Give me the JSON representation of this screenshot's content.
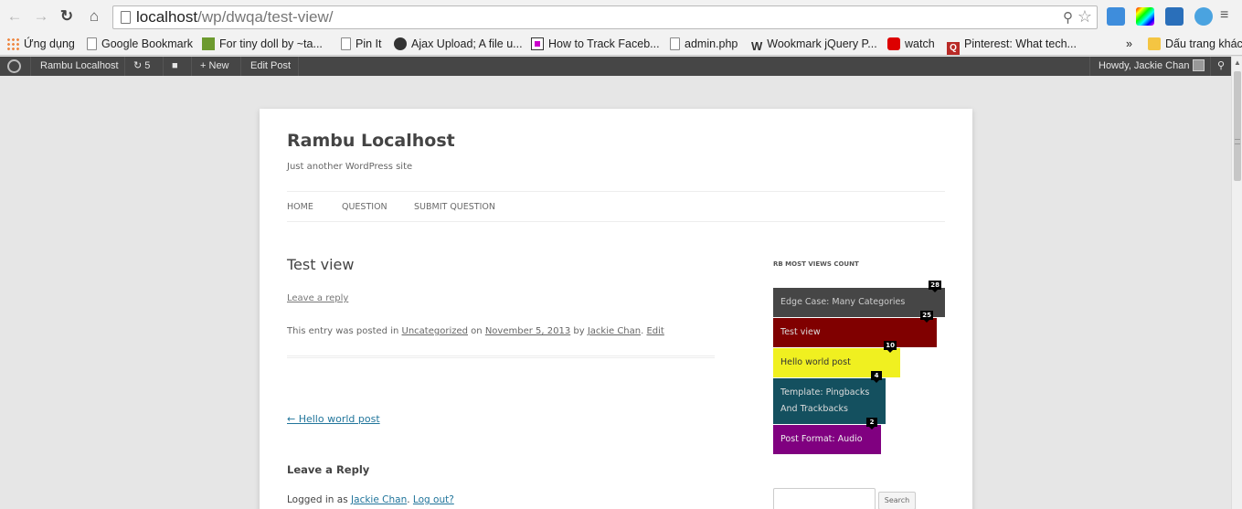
{
  "browser": {
    "url_host": "localhost",
    "url_path": "/wp/dwqa/test-view/",
    "bookmarks": [
      {
        "label": "Ứng dụng",
        "icon": "apps-icon"
      },
      {
        "label": "Google Bookmark",
        "icon": "page-icon"
      },
      {
        "label": "For tiny doll by ~ta...",
        "icon": "deviantart-icon"
      },
      {
        "label": "Pin It",
        "icon": "page-icon"
      },
      {
        "label": "Ajax Upload; A file u...",
        "icon": "github-icon"
      },
      {
        "label": "How to Track Faceb...",
        "icon": "page-icon"
      },
      {
        "label": "admin.php",
        "icon": "page-icon"
      },
      {
        "label": "Wookmark jQuery P...",
        "icon": "wookmark-icon"
      },
      {
        "label": "watch",
        "icon": "youtube-icon"
      },
      {
        "label": "Pinterest: What tech...",
        "icon": "quora-icon"
      }
    ],
    "more_bookmarks": "»",
    "other_bookmarks": "Dấu trang khác"
  },
  "adminbar": {
    "site_name": "Rambu Localhost",
    "updates_count": "5",
    "new_label": "New",
    "edit_label": "Edit Post",
    "howdy": "Howdy, Jackie Chan"
  },
  "site": {
    "title": "Rambu Localhost",
    "description": "Just another WordPress site",
    "nav": [
      "HOME",
      "QUESTION",
      "SUBMIT QUESTION"
    ]
  },
  "entry": {
    "title": "Test view",
    "leave_reply": "Leave a reply",
    "meta_prefix": "This entry was posted in",
    "category": "Uncategorized",
    "meta_on": "on",
    "date": "November 5, 2013",
    "meta_by": "by",
    "author": "Jackie Chan",
    "edit": "Edit",
    "prev_post": "← Hello world post",
    "reply_title": "Leave a Reply",
    "logged_in_prefix": "Logged in as",
    "logged_in_user": "Jackie Chan",
    "logout": "Log out?"
  },
  "widget": {
    "title": "RB MOST VIEWS COUNT",
    "items": [
      {
        "title": "Edge Case: Many Categories",
        "count": "28",
        "bg": "#464646",
        "fg": "#cccccc"
      },
      {
        "title": "Test view",
        "count": "25",
        "bg": "#800000",
        "fg": "#dddddd"
      },
      {
        "title": "Hello world post",
        "count": "10",
        "bg": "#f0f020",
        "fg": "#333333"
      },
      {
        "title": "Template: Pingbacks And Trackbacks",
        "count": "4",
        "bg": "#14505f",
        "fg": "#dddddd"
      },
      {
        "title": "Post Format: Audio",
        "count": "2",
        "bg": "#800080",
        "fg": "#eeeeee"
      }
    ],
    "search_button": "Search"
  }
}
